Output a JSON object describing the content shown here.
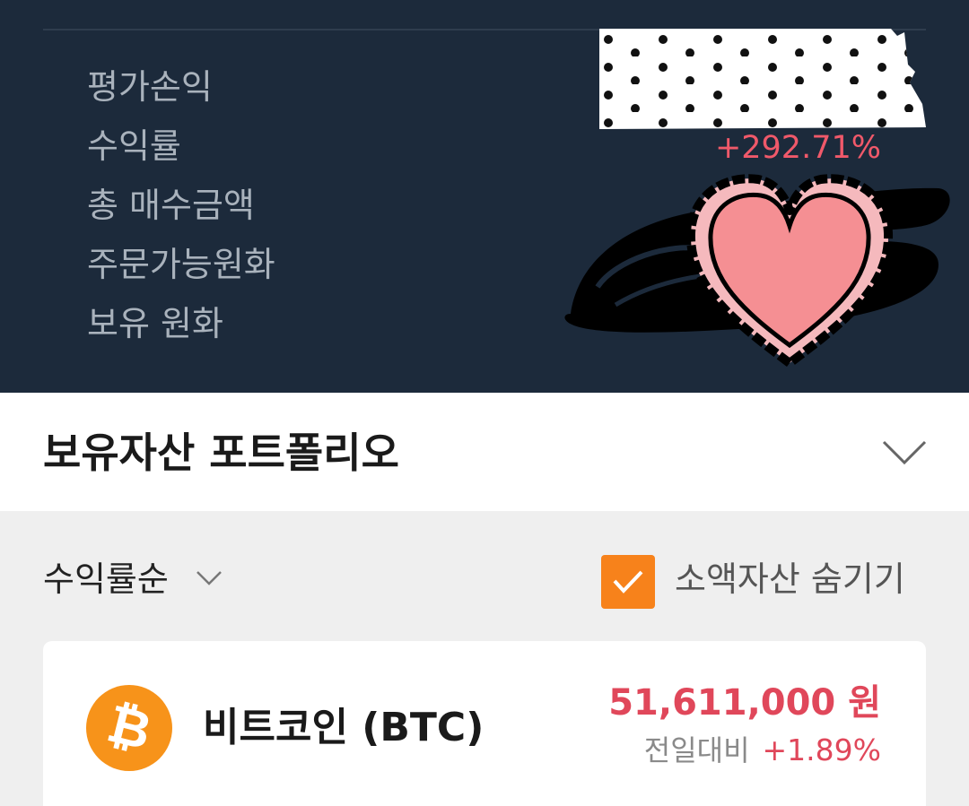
{
  "summary": {
    "labels": [
      "평가손익",
      "수익률",
      "총 매수금액",
      "주문가능원화",
      "보유 원화"
    ],
    "return_rate": "+292.71%"
  },
  "portfolio": {
    "title": "보유자산 포트폴리오"
  },
  "controls": {
    "sort_label": "수익률순",
    "hide_small_label": "소액자산 숨기기",
    "hide_small_checked": true,
    "checkbox_color": "#f7821b"
  },
  "asset": {
    "name": "비트코인 (BTC)",
    "price": "51,611,000 원",
    "change_label": "전일대비",
    "change_value": "+1.89%",
    "icon": "bitcoin-icon",
    "icon_glyph": "₿"
  },
  "colors": {
    "top_bg": "#1c2a3b",
    "positive": "#e0475a",
    "bitcoin": "#f7931a"
  }
}
